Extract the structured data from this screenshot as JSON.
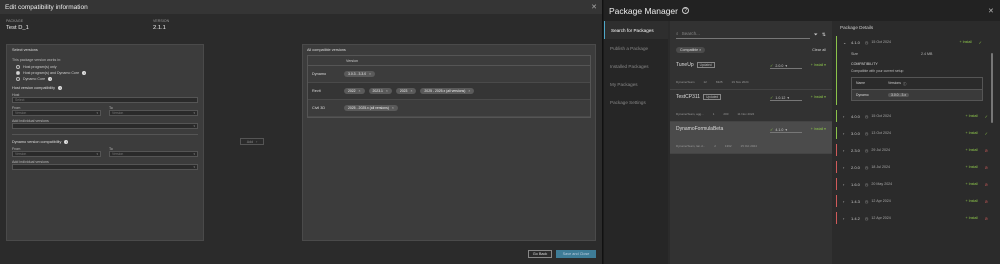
{
  "dialog": {
    "title": "Edit compatibility information",
    "package_label": "PACKAGE",
    "package_value": "Test D_1",
    "version_label": "VERSION",
    "version_value": "2.1.1",
    "select_title": "Select versions",
    "works_in": "This package version works in:",
    "radio": [
      {
        "label": "Host program(s) only",
        "selected": false
      },
      {
        "label": "Host program(s) and Dynamo Core",
        "selected": true
      },
      {
        "label": "Dynamo Core",
        "selected": false
      }
    ],
    "host_compat_title": "Host version compatibility",
    "host_label": "Host",
    "host_placeholder": "Select",
    "from_label": "From",
    "to_label": "To",
    "version_placeholder": "Version",
    "add_individual": "Add individual versions",
    "dynamo_compat_title": "Dynamo version compatibility",
    "add_button": "Add",
    "all_compat_title": "All compatible versions",
    "table_header": "Version",
    "compat_rows": [
      {
        "name": "Dynamo",
        "versions": [
          "3.0.3 - 3.3.0"
        ]
      },
      {
        "name": "Revit",
        "versions": [
          "2022",
          "2023.1",
          "2023",
          "2025 - 2025.x (all versions)"
        ]
      },
      {
        "name": "Civil 3D",
        "versions": [
          "2025 - 2025.x (all versions)"
        ]
      }
    ],
    "back_button": "Go Back",
    "save_button": "Save and Close"
  },
  "pm": {
    "title": "Package Manager",
    "nav": [
      "Search for Packages",
      "Publish a Package",
      "Installed Packages",
      "My Packages",
      "Package Settings"
    ],
    "search_placeholder": "Search...",
    "filter_chip": "Compatible",
    "clear_all": "Clear all",
    "packages": [
      {
        "name": "TuneUp",
        "tag": "Updated",
        "version": "2.0.0",
        "install": "Install",
        "author": "DynamoTeam",
        "votes": "12",
        "downloads": "6325",
        "date": "19 Nov 2024"
      },
      {
        "name": "TestCP311",
        "tag": "Updated",
        "version": "1.0.12",
        "install": "Install",
        "author": "DynamoTeam, agg...",
        "votes": "1",
        "downloads": "200",
        "date": "11 Nov 2024"
      },
      {
        "name": "DynamoFormulaBeta",
        "tag": "",
        "version": "4.1.0",
        "install": "Install",
        "author": "DynamoTeam, lan.d...",
        "votes": "2",
        "downloads": "1362",
        "date": "15 Oct 2024"
      }
    ],
    "details_title": "Package Details",
    "expanded": {
      "version": "4.1.0",
      "date": "15 Oct 2024",
      "install": "Install",
      "size_label": "Size",
      "size_value": "2.4 MB",
      "compat_title": "COMPATIBILITY",
      "compat_sub": "Compatible with your current setup",
      "col_name": "Name",
      "col_versions": "Versions",
      "row_name": "Dynamo",
      "row_versions": "3.0.0 - 3.x"
    },
    "versions": [
      {
        "v": "4.0.0",
        "date": "15 Oct 2024",
        "status": "ok"
      },
      {
        "v": "3.0.0",
        "date": "13 Oct 2024",
        "status": "ok"
      },
      {
        "v": "2.3.0",
        "date": "29 Jul 2024",
        "status": "bad"
      },
      {
        "v": "2.0.0",
        "date": "18 Jul 2024",
        "status": "bad"
      },
      {
        "v": "1.6.0",
        "date": "20 May 2024",
        "status": "bad"
      },
      {
        "v": "1.4.3",
        "date": "12 Apr 2024",
        "status": "bad"
      },
      {
        "v": "1.4.2",
        "date": "12 Apr 2024",
        "status": "bad"
      }
    ],
    "install_label": "Install"
  }
}
